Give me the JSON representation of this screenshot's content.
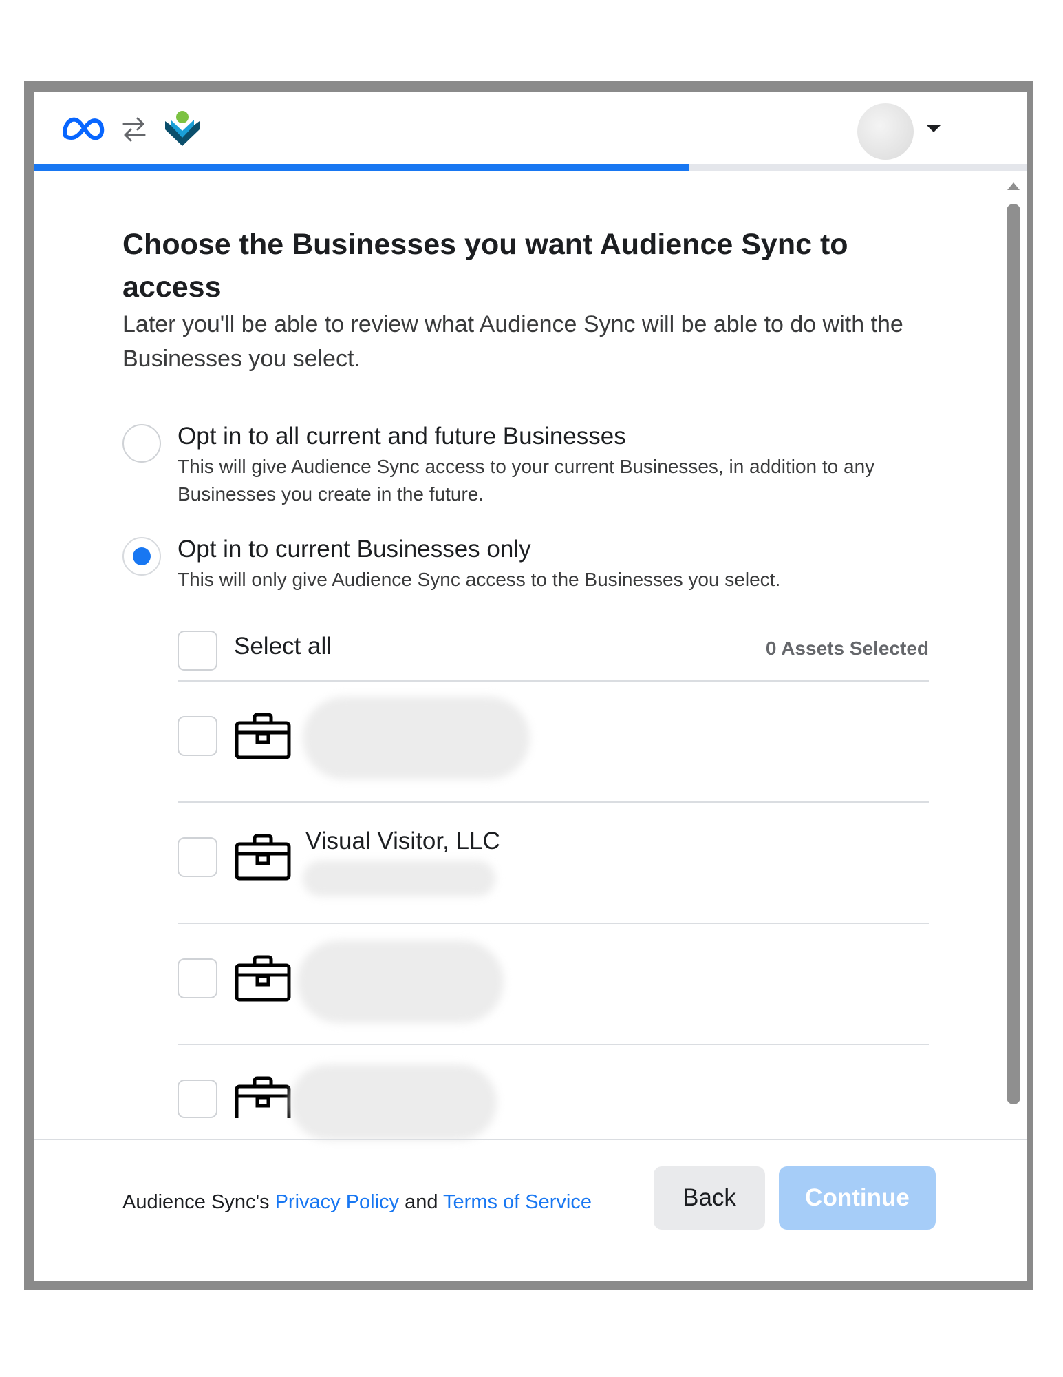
{
  "header": {
    "logos": [
      "meta-logo",
      "swap-icon",
      "audience-sync-logo"
    ],
    "progress_fraction": 0.66
  },
  "main": {
    "title": "Choose the Businesses you want Audience Sync to access",
    "subtitle": "Later you'll be able to review what Audience Sync will be able to do with the Businesses you select.",
    "options": [
      {
        "label": "Opt in to all current and future Businesses",
        "description": "This will give Audience Sync access to your current Businesses, in addition to any Businesses you create in the future.",
        "selected": false
      },
      {
        "label": "Opt in to current Businesses only",
        "description": "This will only give Audience Sync access to the Businesses you select.",
        "selected": true
      }
    ],
    "select_all_label": "Select all",
    "assets_selected": "0 Assets Selected",
    "businesses": [
      {
        "name": "",
        "icon": "briefcase-icon",
        "checked": false
      },
      {
        "name": "Visual Visitor, LLC",
        "icon": "briefcase-icon",
        "checked": false
      },
      {
        "name": "",
        "icon": "briefcase-icon",
        "checked": false
      },
      {
        "name": "",
        "icon": "briefcase-icon",
        "checked": false
      }
    ]
  },
  "footer": {
    "prefix": "Audience Sync's ",
    "privacy_link": "Privacy Policy",
    "and_text": " and ",
    "terms_link": "Terms of Service",
    "back_label": "Back",
    "continue_label": "Continue"
  },
  "colors": {
    "accent": "#1877f2",
    "continue_disabled": "#a6cdf8",
    "back_bg": "#e9eaec",
    "frame": "#8a8a8a"
  }
}
